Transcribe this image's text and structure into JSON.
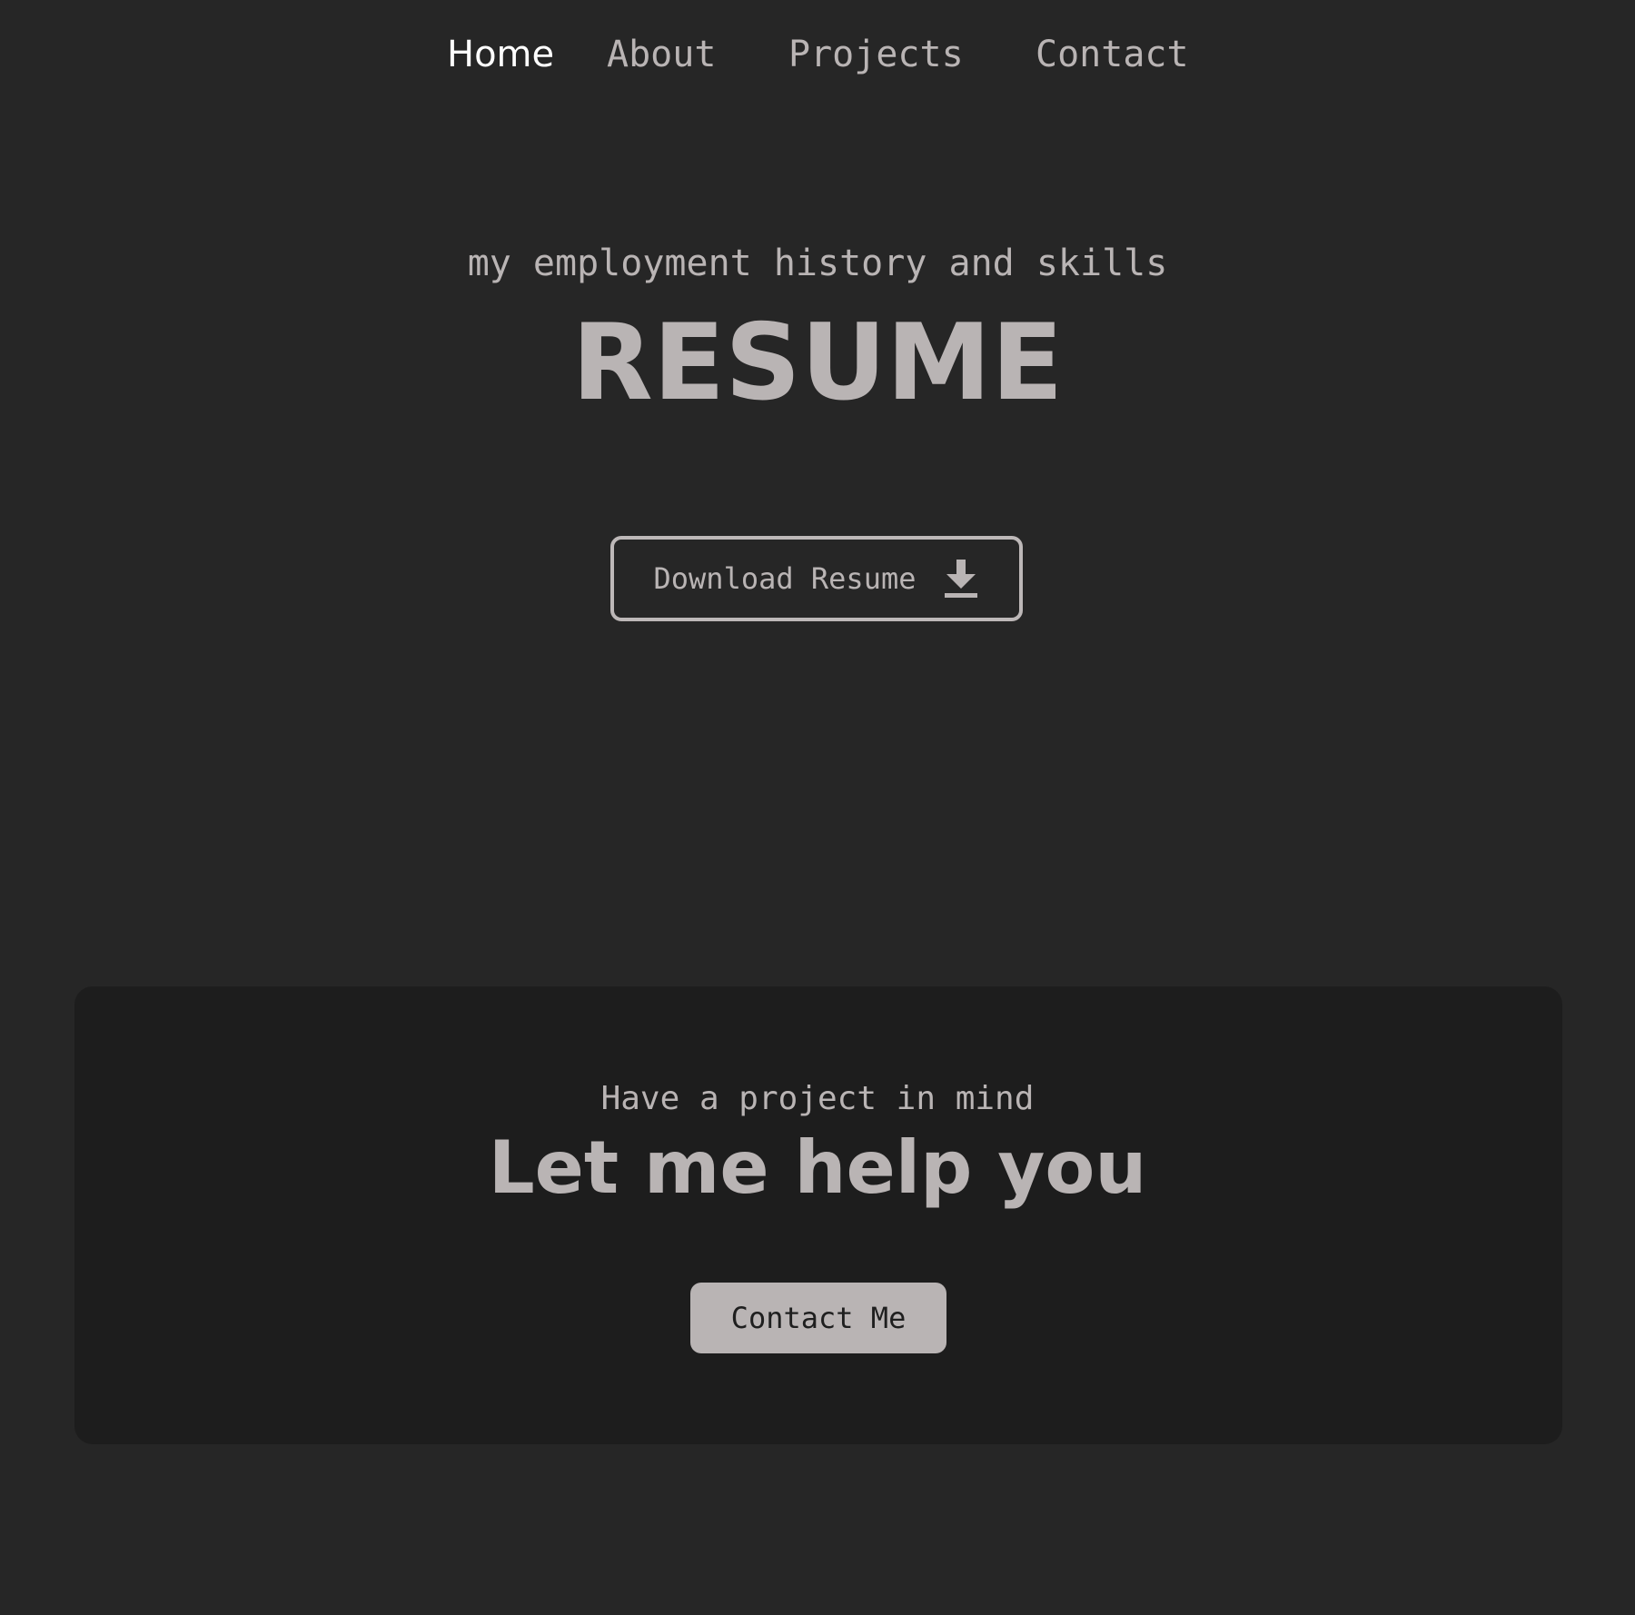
{
  "nav": {
    "items": [
      {
        "label": "Home",
        "active": true
      },
      {
        "label": "About",
        "active": false
      },
      {
        "label": "Projects",
        "active": false
      },
      {
        "label": "Contact",
        "active": false
      }
    ]
  },
  "hero": {
    "subtitle": "my employment history and skills",
    "title": "RESUME",
    "download_button": {
      "label": "Download Resume",
      "icon": "download-icon"
    }
  },
  "cta": {
    "kicker": "Have a project in mind",
    "title": "Let me help you",
    "button_label": "Contact Me"
  },
  "colors": {
    "background": "#262626",
    "card_background": "#1d1d1d",
    "text": "#b9b4b4",
    "active_nav": "#ffffff",
    "button_fill": "#b9b4b4",
    "button_text": "#1f1f1f"
  }
}
